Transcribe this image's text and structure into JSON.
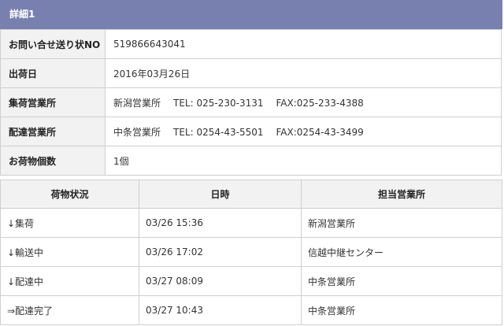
{
  "section": {
    "title": "詳細1"
  },
  "details": {
    "tracking": {
      "label": "お問い合せ送り状NO",
      "value": "519866643041"
    },
    "ship_date": {
      "label": "出荷日",
      "value": "2016年03月26日"
    },
    "pickup_office": {
      "label": "集荷営業所",
      "name": "新潟営業所",
      "tel": "TEL: 025-230-3131",
      "fax": "FAX:025-233-4388"
    },
    "delivery_office": {
      "label": "配達営業所",
      "name": "中条営業所",
      "tel": "TEL: 0254-43-5501",
      "fax": "FAX:0254-43-3499"
    },
    "count": {
      "label": "お荷物個数",
      "value": "1個"
    }
  },
  "status_table": {
    "headers": [
      "荷物状況",
      "日時",
      "担当営業所"
    ],
    "rows": [
      {
        "status": "↓集荷",
        "datetime": "03/26 15:36",
        "office": "新潟営業所"
      },
      {
        "status": "↓輸送中",
        "datetime": "03/26 17:02",
        "office": "信越中継センター"
      },
      {
        "status": "↓配達中",
        "datetime": "03/27 08:09",
        "office": "中条営業所"
      },
      {
        "status": "⇒配達完了",
        "datetime": "03/27 10:43",
        "office": "中条営業所"
      }
    ]
  },
  "colors": {
    "header_bg": "#7880b0",
    "label_bg": "#f2f2f2",
    "border": "#cfcfcf"
  }
}
